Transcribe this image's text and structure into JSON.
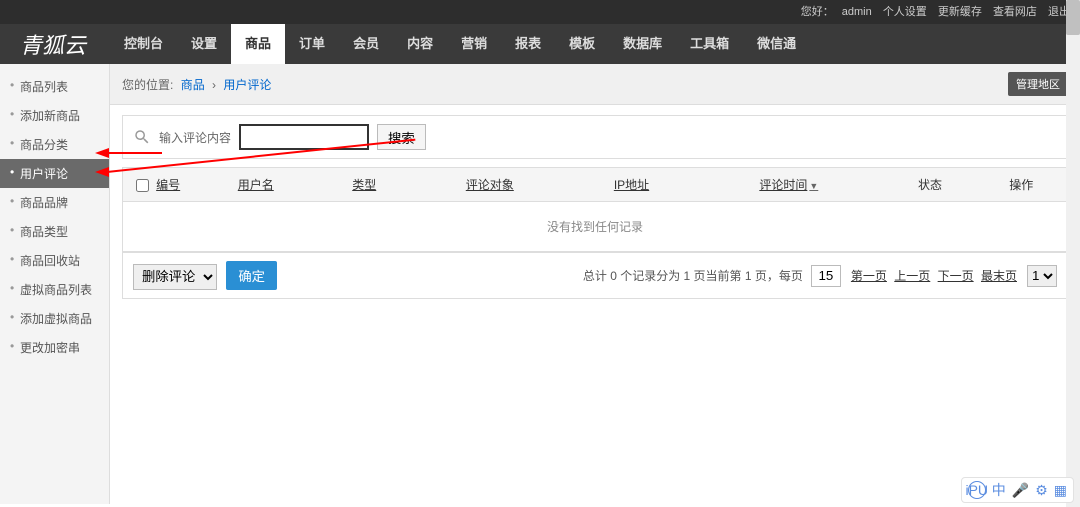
{
  "topbar": {
    "greeting_prefix": "您好：",
    "user": "admin",
    "links": {
      "profile": "个人设置",
      "refresh": "更新缓存",
      "view_store": "查看网店",
      "logout": "退出"
    }
  },
  "logo": "青狐云",
  "nav": [
    "控制台",
    "设置",
    "商品",
    "订单",
    "会员",
    "内容",
    "营销",
    "报表",
    "模板",
    "数据库",
    "工具箱",
    "微信通"
  ],
  "nav_active_index": 2,
  "sidebar": {
    "items": [
      "商品列表",
      "添加新商品",
      "商品分类",
      "用户评论",
      "商品品牌",
      "商品类型",
      "商品回收站",
      "虚拟商品列表",
      "添加虚拟商品",
      "更改加密串"
    ],
    "active_index": 3
  },
  "breadcrumb": {
    "label": "您的位置:",
    "crumb1": "商品",
    "sep": "›",
    "crumb2": "用户评论",
    "manage_btn": "管理地区"
  },
  "search": {
    "label": "输入评论内容",
    "placeholder": "",
    "button": "搜索"
  },
  "table": {
    "columns": {
      "id": "编号",
      "user": "用户名",
      "type": "类型",
      "target": "评论对象",
      "ip": "IP地址",
      "time": "评论时间",
      "status": "状态",
      "action": "操作"
    },
    "nodata": "没有找到任何记录"
  },
  "bulk": {
    "default_option": "删除评论",
    "confirm": "确定"
  },
  "pager": {
    "summary_pre": "总计 0 个记录分为 1 页当前第 1 页，每页",
    "page_size": "15",
    "first": "第一页",
    "prev": "上一页",
    "next": "下一页",
    "last": "最末页",
    "select_value": "1"
  },
  "floatbar": {
    "ipu": "iPU",
    "cn": "中",
    "mic": "🎤",
    "gear": "⚙",
    "grid": "▦"
  }
}
